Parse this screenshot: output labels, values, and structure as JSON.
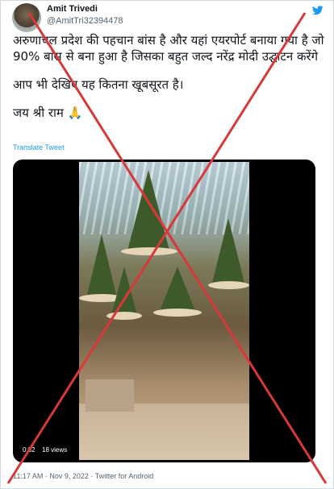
{
  "author": {
    "name": "Amit Trivedi",
    "handle": "@AmitTri32394478"
  },
  "tweet": {
    "line1": "अरुणाचल प्रदेश की पहचान बांस है और यहां एयरपोर्ट बनाया गया है जो 90% बांस से बना हुआ है जिसका बहुत जल्द नरेंद्र मोदी उद्घाटन करेंगे",
    "line2": "आप भी देखिए यह कितना खूबसूरत है।",
    "line3": "जय श्री राम 🙏",
    "translate_label": "Translate Tweet"
  },
  "video": {
    "timecode": "0:32",
    "views": "18 views"
  },
  "meta": "11:17 AM · Nov 9, 2022 · Twitter for Android",
  "colors": {
    "link": "#1d9bf0",
    "cross": "#d9383a"
  }
}
